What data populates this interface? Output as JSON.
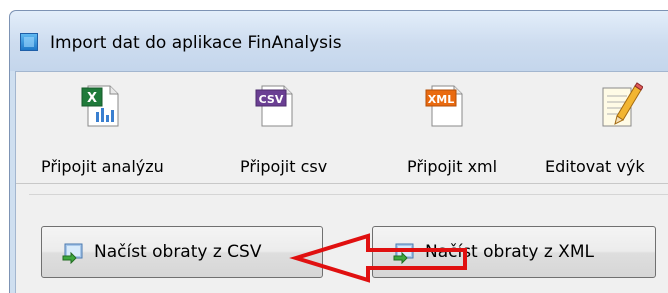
{
  "window": {
    "title": "Import dat do aplikace FinAnalysis"
  },
  "toolbar": {
    "items": [
      {
        "label": "Připojit analýzu",
        "icon": "excel-icon"
      },
      {
        "label": "Připojit csv",
        "icon": "csv-file-icon",
        "badge": "CSV"
      },
      {
        "label": "Připojit xml",
        "icon": "xml-file-icon",
        "badge": "XML"
      },
      {
        "label": "Editovat výk",
        "icon": "edit-pencil-icon"
      }
    ]
  },
  "buttons": {
    "load_csv": "Načíst obraty z CSV",
    "load_xml": "Načíst obraty z XML"
  },
  "colors": {
    "arrow": "#e01010",
    "csv_badge": "#6a3f93",
    "xml_badge": "#e96a10",
    "excel_green": "#1f7a3a"
  }
}
